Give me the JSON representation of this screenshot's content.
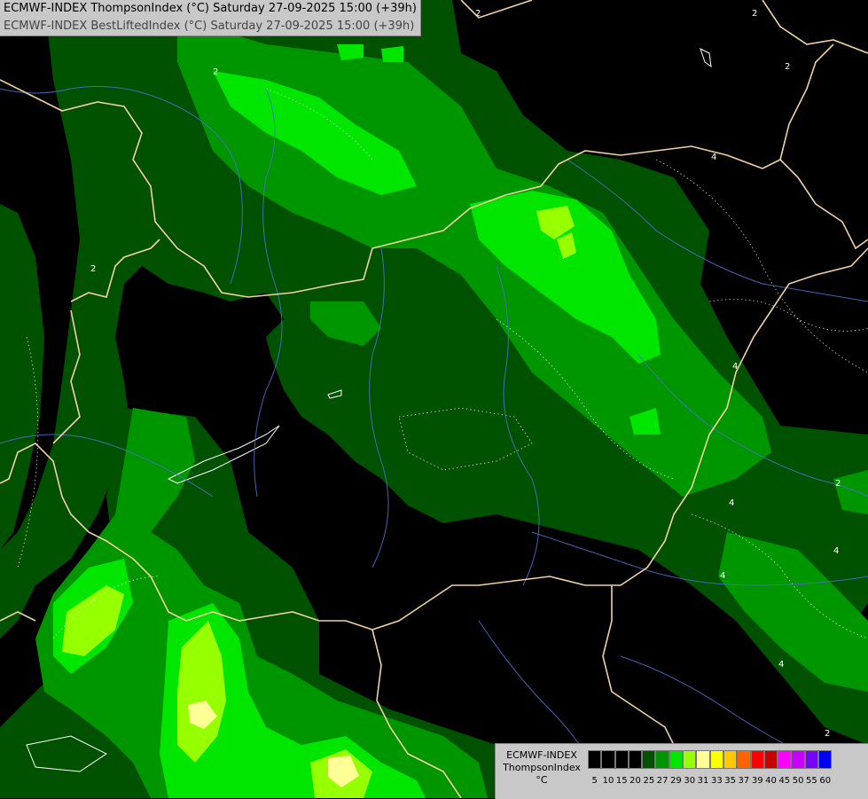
{
  "title": {
    "line1": "ECMWF-INDEX ThompsonIndex (°C) Saturday 27-09-2025 15:00 (+39h)",
    "line2": "ECMWF-INDEX BestLiftedIndex (°C) Saturday 27-09-2025 15:00 (+39h)"
  },
  "legend": {
    "model": "ECMWF-INDEX",
    "field": "ThompsonIndex",
    "unit": "°C",
    "bins": [
      {
        "label": "5",
        "color": "#000000"
      },
      {
        "label": "10",
        "color": "#000000"
      },
      {
        "label": "15",
        "color": "#000000"
      },
      {
        "label": "20",
        "color": "#000000"
      },
      {
        "label": "25",
        "color": "#005200"
      },
      {
        "label": "27",
        "color": "#009600"
      },
      {
        "label": "29",
        "color": "#00e600"
      },
      {
        "label": "30",
        "color": "#96ff00"
      },
      {
        "label": "31",
        "color": "#ffff96"
      },
      {
        "label": "33",
        "color": "#ffff00"
      },
      {
        "label": "35",
        "color": "#ffc800"
      },
      {
        "label": "37",
        "color": "#ff6400"
      },
      {
        "label": "39",
        "color": "#ff0000"
      },
      {
        "label": "40",
        "color": "#c80000"
      },
      {
        "label": "45",
        "color": "#ff00ff"
      },
      {
        "label": "50",
        "color": "#c800ff"
      },
      {
        "label": "55",
        "color": "#7800ff"
      },
      {
        "label": "60",
        "color": "#0000ff"
      }
    ]
  },
  "contour_labels": [
    "2",
    "2",
    "2",
    "2",
    "4",
    "2",
    "4",
    "4",
    "4",
    "4",
    "4",
    "2",
    "2"
  ],
  "colors": {
    "border": "#f0d2a0",
    "river": "#4a6fc8",
    "contour": "#ffffff"
  }
}
